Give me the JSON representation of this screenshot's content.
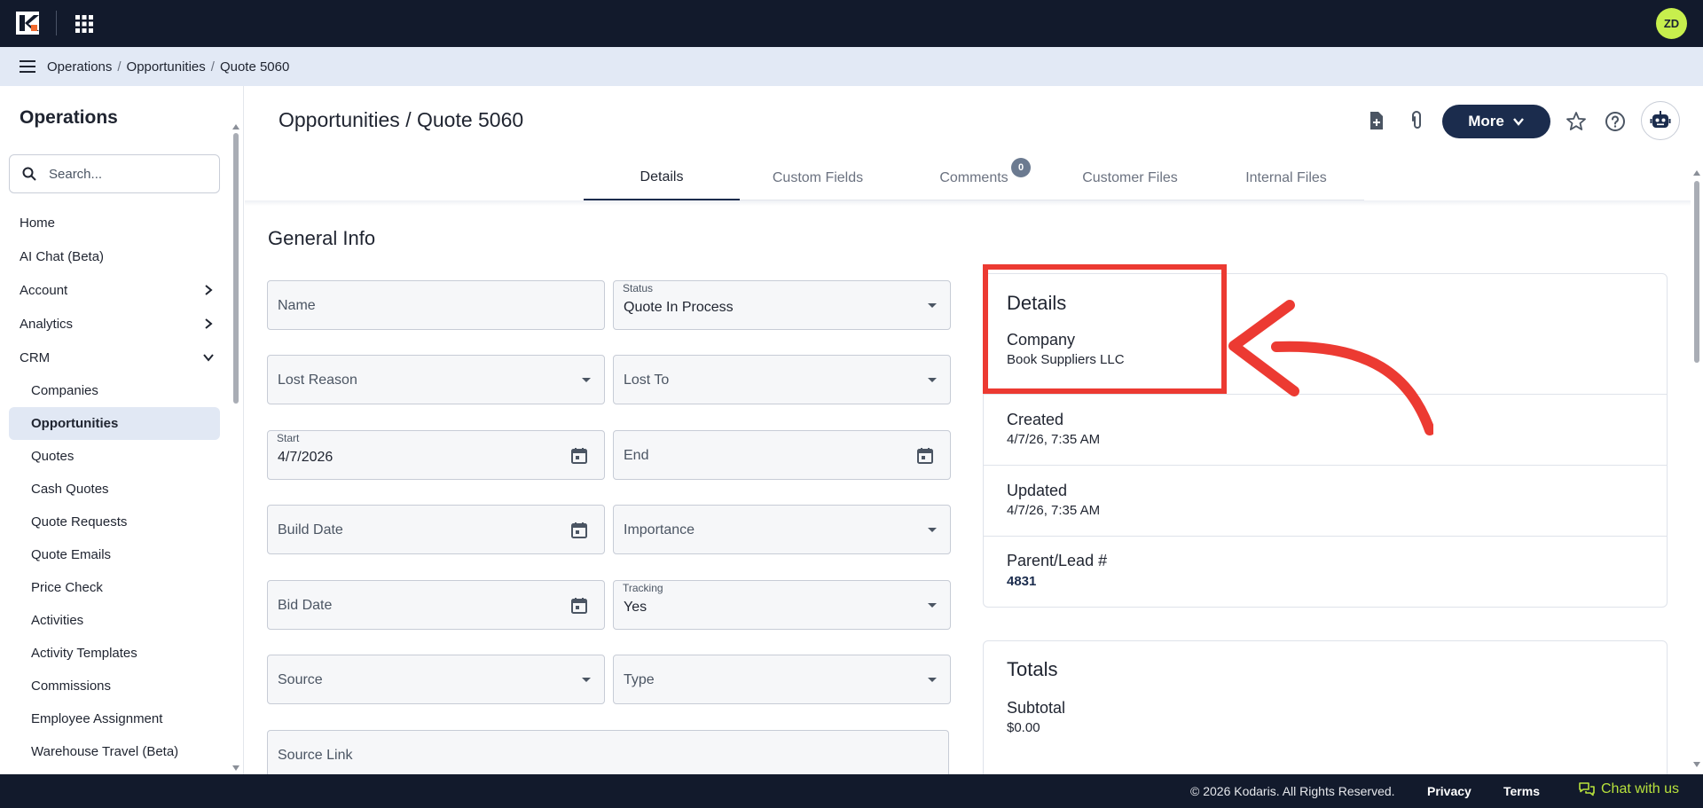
{
  "topbar": {
    "avatar_initials": "ZD",
    "brand_color": "#121a2c",
    "avatar_color": "#c7ef4d"
  },
  "breadcrumb": {
    "items": [
      "Operations",
      "Opportunities",
      "Quote 5060"
    ],
    "separator": "/"
  },
  "sidebar": {
    "title": "Operations",
    "search_placeholder": "Search...",
    "items": [
      {
        "label": "Home"
      },
      {
        "label": "AI Chat (Beta)"
      },
      {
        "label": "Account",
        "icon": "chevron-right-icon"
      },
      {
        "label": "Analytics",
        "icon": "chevron-right-icon"
      },
      {
        "label": "CRM",
        "icon": "chevron-down-icon"
      }
    ],
    "crm_items": [
      {
        "label": "Companies"
      },
      {
        "label": "Opportunities",
        "active": true
      },
      {
        "label": "Quotes"
      },
      {
        "label": "Cash Quotes"
      },
      {
        "label": "Quote Requests"
      },
      {
        "label": "Quote Emails"
      },
      {
        "label": "Price Check"
      },
      {
        "label": "Activities"
      },
      {
        "label": "Activity Templates"
      },
      {
        "label": "Commissions"
      },
      {
        "label": "Employee Assignment"
      },
      {
        "label": "Warehouse Travel (Beta)"
      }
    ]
  },
  "header": {
    "title": "Opportunities / Quote 5060",
    "more_label": "More",
    "icons": [
      "add-document-icon",
      "paperclip-icon",
      "star-icon",
      "help-icon",
      "bot-icon"
    ]
  },
  "tabs": [
    {
      "label": "Details",
      "active": true
    },
    {
      "label": "Custom Fields"
    },
    {
      "label": "Comments",
      "badge": "0"
    },
    {
      "label": "Customer Files"
    },
    {
      "label": "Internal Files"
    }
  ],
  "general_info": {
    "title": "General Info",
    "fields": {
      "name": {
        "placeholder": "Name"
      },
      "status": {
        "label": "Status",
        "value": "Quote In Process"
      },
      "lost_reason": {
        "placeholder": "Lost Reason"
      },
      "lost_to": {
        "placeholder": "Lost To"
      },
      "start": {
        "label": "Start",
        "value": "4/7/2026"
      },
      "end": {
        "placeholder": "End"
      },
      "build_date": {
        "placeholder": "Build Date"
      },
      "importance": {
        "placeholder": "Importance"
      },
      "bid_date": {
        "placeholder": "Bid Date"
      },
      "tracking": {
        "label": "Tracking",
        "value": "Yes"
      },
      "source": {
        "placeholder": "Source"
      },
      "type": {
        "placeholder": "Type"
      },
      "source_link": {
        "placeholder": "Source Link"
      }
    }
  },
  "details_card": {
    "title": "Details",
    "company_label": "Company",
    "company_value": "Book Suppliers LLC",
    "created_label": "Created",
    "created_value": "4/7/26, 7:35 AM",
    "updated_label": "Updated",
    "updated_value": "4/7/26, 7:35 AM",
    "parent_label": "Parent/Lead #",
    "parent_value": "4831"
  },
  "totals_card": {
    "title": "Totals",
    "subtotal_label": "Subtotal",
    "subtotal_value": "$0.00"
  },
  "annotation": {
    "highlight_color": "#ec3a32"
  },
  "footer": {
    "copyright": "© 2026 Kodaris. All Rights Reserved.",
    "privacy": "Privacy",
    "terms": "Terms",
    "chat": "Chat with us"
  }
}
